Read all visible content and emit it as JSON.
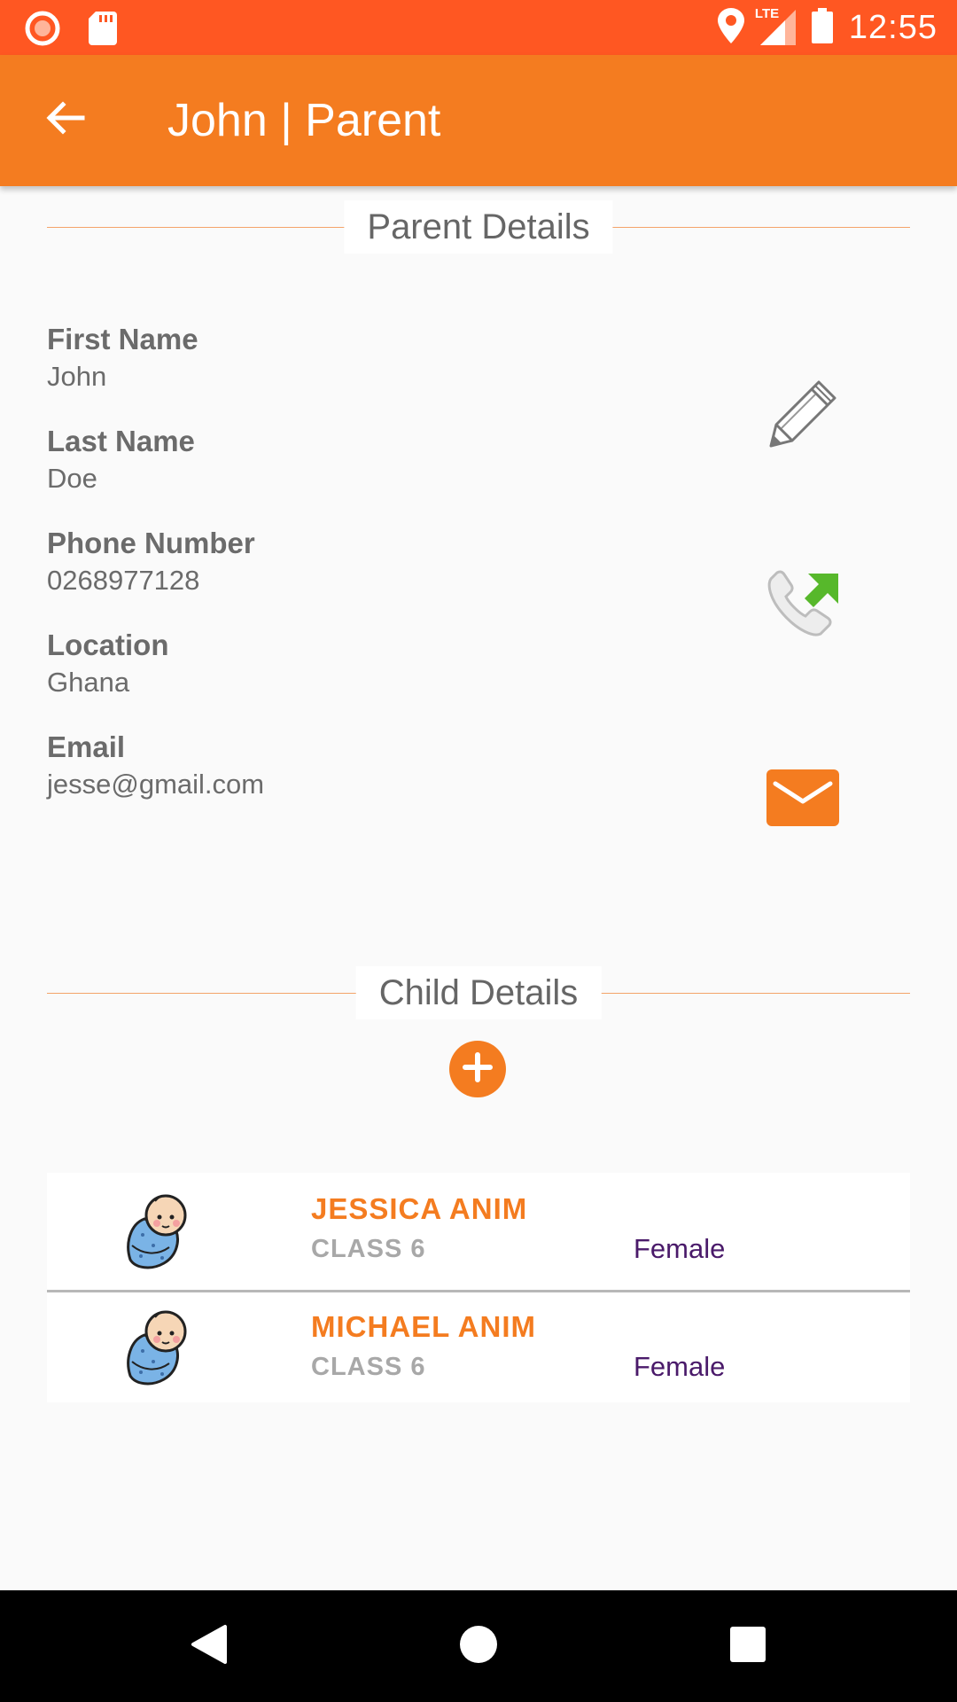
{
  "status_bar": {
    "time": "12:55",
    "network": "LTE",
    "icons": [
      "record-icon",
      "sd-card-icon",
      "location-icon",
      "signal-icon",
      "battery-icon"
    ]
  },
  "app_bar": {
    "title": "John | Parent",
    "back_icon": "arrow-left-icon"
  },
  "parent_section": {
    "heading": "Parent Details",
    "fields": [
      {
        "label": "First Name",
        "value": "John"
      },
      {
        "label": "Last Name",
        "value": "Doe"
      },
      {
        "label": "Phone Number",
        "value": "0268977128"
      },
      {
        "label": "Location",
        "value": "Ghana"
      },
      {
        "label": "Email",
        "value": "jesse@gmail.com"
      }
    ],
    "actions": [
      "pencil-icon",
      "call-outgoing-icon",
      "email-icon"
    ]
  },
  "child_section": {
    "heading": "Child Details",
    "add_icon": "plus-circle-icon",
    "children": [
      {
        "name": "JESSICA ANIM",
        "class": "CLASS 6",
        "gender": "Female",
        "avatar": "baby-icon"
      },
      {
        "name": "MICHAEL ANIM",
        "class": "CLASS 6",
        "gender": "Female",
        "avatar": "baby-icon"
      }
    ]
  },
  "colors": {
    "status_bar": "#ff5722",
    "app_bar": "#f47c20",
    "accent": "#f47c20",
    "gender_text": "#4a1a6a"
  },
  "nav_bar": {
    "icons": [
      "back-triangle-icon",
      "home-circle-icon",
      "recents-square-icon"
    ]
  }
}
